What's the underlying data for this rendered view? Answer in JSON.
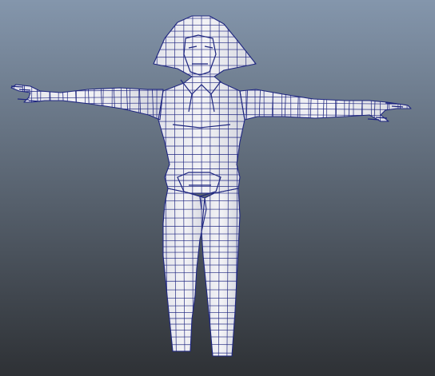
{
  "viewport": {
    "background_top": "#8496ac",
    "background_bottom": "#2e3135",
    "mesh_fill": "#eeeef2",
    "mesh_shade": "#c9cbd3",
    "wire_color": "#1e2680"
  },
  "model": {
    "icon": "t-pose-character-mesh-icon",
    "display_mode": "wireframe-on-shaded"
  }
}
